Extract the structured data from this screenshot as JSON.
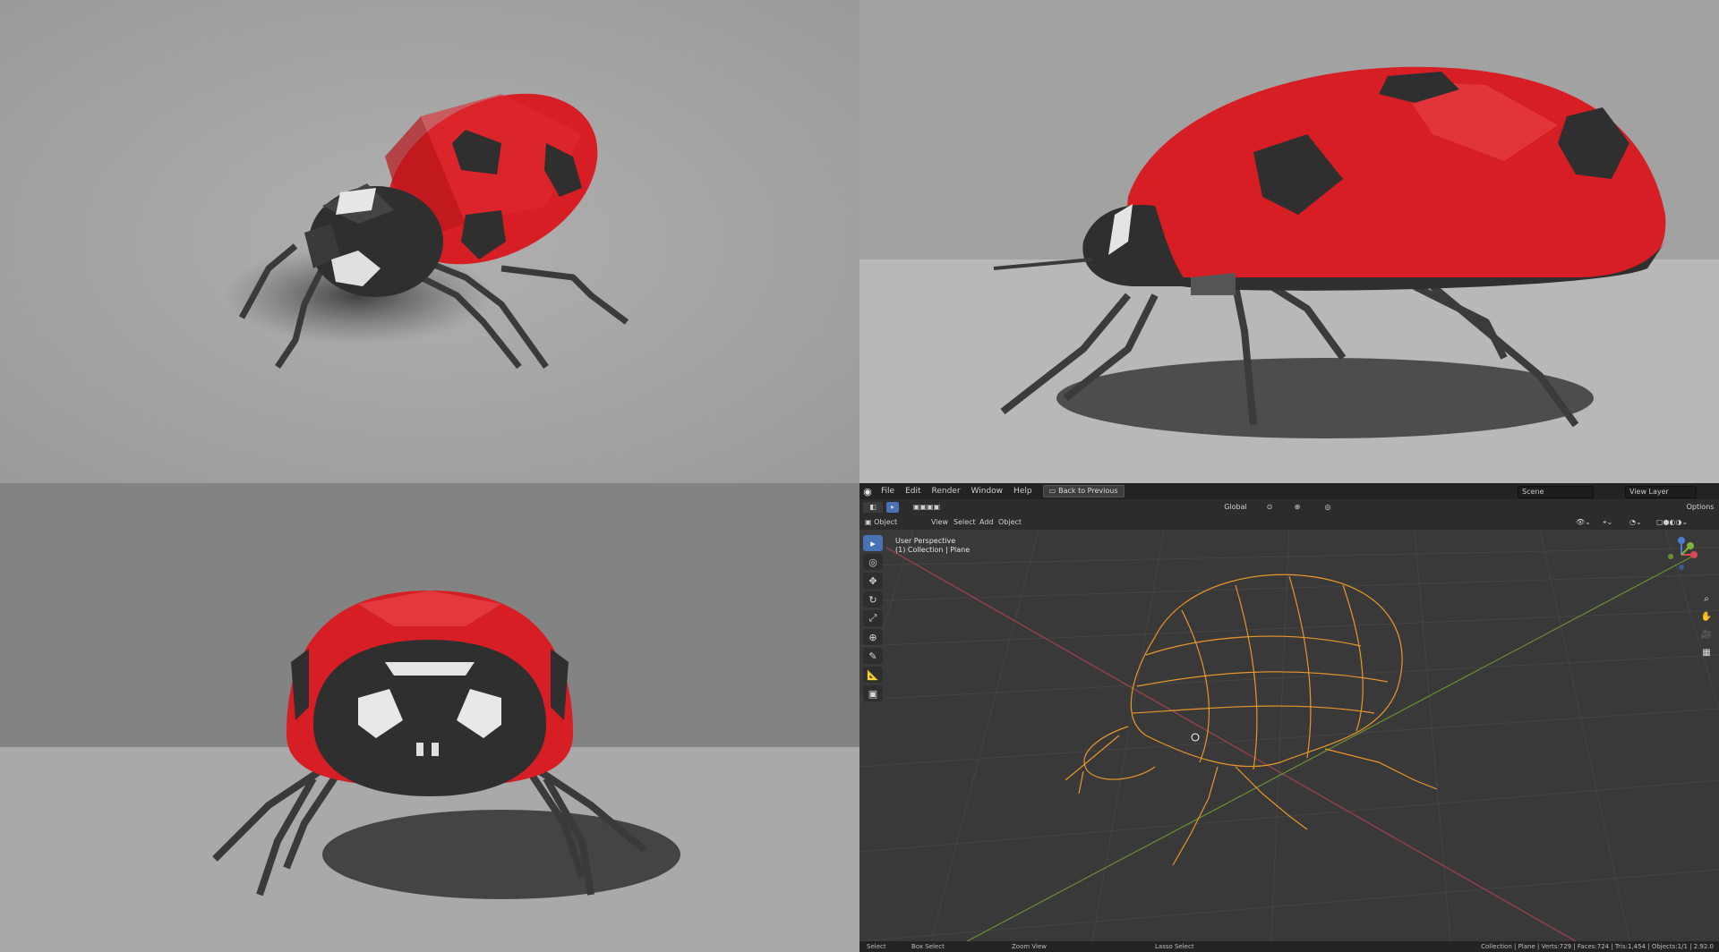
{
  "menu": {
    "items": [
      "File",
      "Edit",
      "Render",
      "Window",
      "Help"
    ],
    "back_button": "Back to Previous",
    "scene": "Scene",
    "view_layer": "View Layer"
  },
  "header": {
    "orientation": "Global",
    "options": "Options",
    "mode": "Object Mode",
    "menu3": [
      "View",
      "Select",
      "Add",
      "Object"
    ]
  },
  "viewport": {
    "perspective_label": "User Perspective",
    "collection_label": "(1) Collection | Plane"
  },
  "status": {
    "select": "Select",
    "box_select": "Box Select",
    "zoom_view": "Zoom View",
    "lasso_select": "Lasso Select",
    "stats": "Collection | Plane | Verts:729 | Faces:724 | Tris:1,454 | Objects:1/1 | 2.92.0"
  },
  "colors": {
    "shell_red": "#d61e24",
    "body_dark": "#2f2f2f",
    "wire_orange": "#e8962a",
    "accent_blue": "#4772b3"
  },
  "icons": [
    "blender-logo-icon",
    "select-tool-icon",
    "cursor-icon",
    "move-icon",
    "rotate-icon",
    "scale-icon",
    "transform-icon",
    "annotate-icon",
    "measure-icon",
    "add-cube-icon",
    "zoom-icon",
    "hand-icon",
    "camera-icon",
    "grid-icon"
  ]
}
